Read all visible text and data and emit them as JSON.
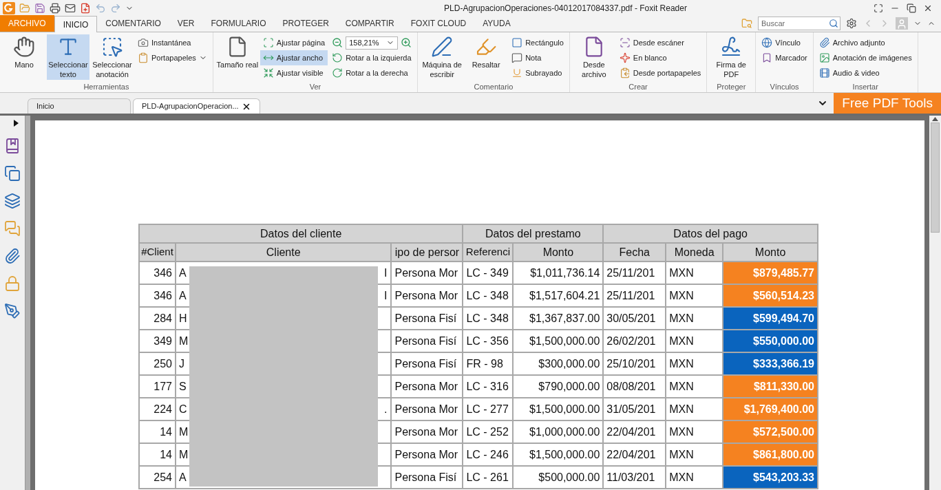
{
  "window": {
    "title": "PLD-AgrupacionOperaciones-04012017084337.pdf - Foxit Reader"
  },
  "menu_tabs": [
    {
      "label": "ARCHIVO",
      "kind": "file",
      "selected": false
    },
    {
      "label": "INICIO",
      "kind": "tab",
      "selected": true
    },
    {
      "label": "COMENTARIO",
      "kind": "tab",
      "selected": false
    },
    {
      "label": "VER",
      "kind": "tab",
      "selected": false
    },
    {
      "label": "FORMULARIO",
      "kind": "tab",
      "selected": false
    },
    {
      "label": "PROTEGER",
      "kind": "tab",
      "selected": false
    },
    {
      "label": "COMPARTIR",
      "kind": "tab",
      "selected": false
    },
    {
      "label": "FOXIT CLOUD",
      "kind": "tab",
      "selected": false
    },
    {
      "label": "AYUDA",
      "kind": "tab",
      "selected": false
    }
  ],
  "search": {
    "placeholder": "Buscar"
  },
  "ribbon": {
    "groups": [
      {
        "label": "Herramientas",
        "large": [
          {
            "label": "Mano",
            "selected": false
          },
          {
            "label": "Seleccionar texto",
            "selected": true
          },
          {
            "label": "Seleccionar anotación",
            "selected": false
          }
        ],
        "columns": [
          [
            {
              "kind": "button",
              "label": "Instantánea",
              "selected": false,
              "dropdown": false
            },
            {
              "kind": "button",
              "label": "Portapapeles",
              "selected": false,
              "dropdown": true
            }
          ]
        ]
      },
      {
        "label": "Ver",
        "large": [
          {
            "label": "Tamaño real",
            "selected": false
          }
        ],
        "columns": [
          [
            {
              "kind": "button",
              "label": "Ajustar página",
              "selected": false,
              "dropdown": false
            },
            {
              "kind": "button",
              "label": "Ajustar ancho",
              "selected": true,
              "dropdown": false
            },
            {
              "kind": "button",
              "label": "Ajustar visible",
              "selected": false,
              "dropdown": false
            }
          ],
          [
            {
              "kind": "zoom",
              "value": "158,21%"
            },
            {
              "kind": "button",
              "label": "Rotar a la izquierda",
              "selected": false,
              "dropdown": false
            },
            {
              "kind": "button",
              "label": "Rotar a la derecha",
              "selected": false,
              "dropdown": false
            }
          ]
        ]
      },
      {
        "label": "Comentario",
        "large": [
          {
            "label": "Máquina de escribir",
            "selected": false
          },
          {
            "label": "Resaltar",
            "selected": false
          }
        ],
        "columns": [
          [
            {
              "kind": "button",
              "label": "Rectángulo",
              "selected": false,
              "dropdown": false
            },
            {
              "kind": "button",
              "label": "Nota",
              "selected": false,
              "dropdown": false
            },
            {
              "kind": "button",
              "label": "Subrayado",
              "selected": false,
              "dropdown": false
            }
          ]
        ]
      },
      {
        "label": "Crear",
        "large": [
          {
            "label": "Desde archivo",
            "selected": false
          }
        ],
        "columns": [
          [
            {
              "kind": "button",
              "label": "Desde escáner",
              "selected": false,
              "dropdown": false
            },
            {
              "kind": "button",
              "label": "En blanco",
              "selected": false,
              "dropdown": false
            },
            {
              "kind": "button",
              "label": "Desde portapapeles",
              "selected": false,
              "dropdown": false
            }
          ]
        ]
      },
      {
        "label": "Proteger",
        "large": [
          {
            "label": "Firma de PDF",
            "selected": false
          }
        ]
      },
      {
        "label": "Vínculos",
        "columns": [
          [
            {
              "kind": "button",
              "label": "Vínculo",
              "selected": false,
              "dropdown": false
            },
            {
              "kind": "button",
              "label": "Marcador",
              "selected": false,
              "dropdown": false
            }
          ]
        ]
      },
      {
        "label": "Insertar",
        "columns": [
          [
            {
              "kind": "button",
              "label": "Archivo adjunto",
              "selected": false,
              "dropdown": false
            },
            {
              "kind": "button",
              "label": "Anotación de imágenes",
              "selected": false,
              "dropdown": false
            },
            {
              "kind": "button",
              "label": "Audio & video",
              "selected": false,
              "dropdown": false
            }
          ]
        ]
      }
    ]
  },
  "doc_tabs": [
    {
      "label": "Inicio",
      "selected": false,
      "closable": false
    },
    {
      "label": "PLD-AgrupacionOperacion...",
      "selected": true,
      "closable": true
    }
  ],
  "promo_button": "Free PDF Tools",
  "table": {
    "groups": [
      {
        "label": "Datos del cliente"
      },
      {
        "label": "Datos del prestamo"
      },
      {
        "label": "Datos del pago"
      }
    ],
    "columns": [
      "#Client",
      "Cliente",
      "ipo de persor",
      "Referenci",
      "Monto",
      "Fecha",
      "Moneda",
      "Monto"
    ],
    "rows": [
      {
        "id": "346",
        "client_start": "A",
        "client_end": "I",
        "tipo": "Persona Mor",
        "ref": "LC - 349",
        "monto": "$1,011,736.14",
        "fecha": "25/11/201",
        "moneda": "MXN",
        "pago": "$879,485.77",
        "color": "#f58220"
      },
      {
        "id": "346",
        "client_start": "A",
        "client_end": "I",
        "tipo": "Persona Mor",
        "ref": "LC - 348",
        "monto": "$1,517,604.21",
        "fecha": "25/11/201",
        "moneda": "MXN",
        "pago": "$560,514.23",
        "color": "#f58220"
      },
      {
        "id": "284",
        "client_start": "H",
        "tipo": "Persona Fisí",
        "ref": "LC - 348",
        "monto": "$1,367,837.00",
        "fecha": "30/05/201",
        "moneda": "MXN",
        "pago": "$599,494.70",
        "color": "#0a64be"
      },
      {
        "id": "349",
        "client_start": "M",
        "tipo": "Persona Fisí",
        "ref": "LC - 356",
        "monto": "$1,500,000.00",
        "fecha": "26/02/201",
        "moneda": "MXN",
        "pago": "$550,000.00",
        "color": "#0a64be"
      },
      {
        "id": "250",
        "client_start": "J",
        "tipo": "Persona Fisí",
        "ref": "FR - 98",
        "monto": "$300,000.00",
        "fecha": "25/10/201",
        "moneda": "MXN",
        "pago": "$333,366.19",
        "color": "#0a64be"
      },
      {
        "id": "177",
        "client_start": "S",
        "tipo": "Persona Mor",
        "ref": "LC - 316",
        "monto": "$790,000.00",
        "fecha": "08/08/201",
        "moneda": "MXN",
        "pago": "$811,330.00",
        "color": "#f58220"
      },
      {
        "id": "224",
        "client_start": "C",
        "client_end": ".",
        "tipo": "Persona Mor",
        "ref": "LC - 277",
        "monto": "$1,500,000.00",
        "fecha": "31/05/201",
        "moneda": "MXN",
        "pago": "$1,769,400.00",
        "color": "#f58220"
      },
      {
        "id": "14",
        "client_start": "M",
        "tipo": "Persona Mor",
        "ref": "LC - 252",
        "monto": "$1,000,000.00",
        "fecha": "22/04/201",
        "moneda": "MXN",
        "pago": "$572,500.00",
        "color": "#f58220"
      },
      {
        "id": "14",
        "client_start": "M",
        "tipo": "Persona Mor",
        "ref": "LC - 246",
        "monto": "$1,500,000.00",
        "fecha": "22/04/201",
        "moneda": "MXN",
        "pago": "$861,800.00",
        "color": "#f58220"
      },
      {
        "id": "254",
        "client_start": "A",
        "tipo": "Persona Fisí",
        "ref": "LC - 261",
        "monto": "$500,000.00",
        "fecha": "11/03/201",
        "moneda": "MXN",
        "pago": "$543,203.33",
        "color": "#0a64be"
      }
    ]
  }
}
